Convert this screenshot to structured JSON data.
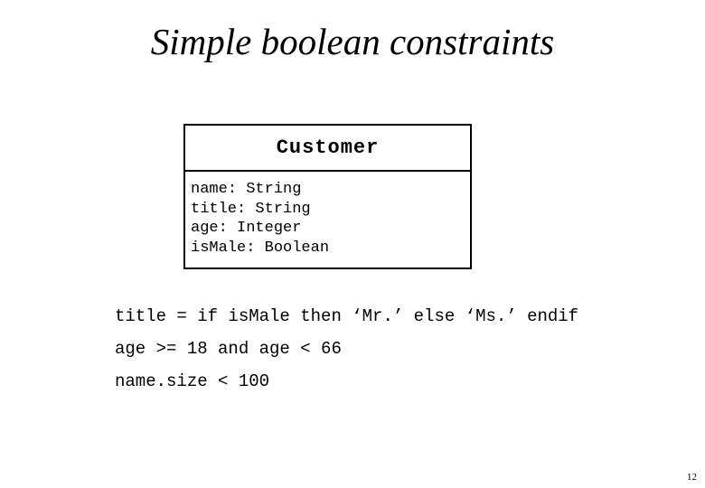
{
  "slide": {
    "title": "Simple boolean constraints",
    "page_number": "12",
    "background_color": "#ffffff",
    "text_color": "#000000"
  },
  "class_box": {
    "name": "Customer",
    "attributes": [
      {
        "text": "name: String"
      },
      {
        "text": "title: String"
      },
      {
        "text": "age: Integer"
      },
      {
        "text": "isMale: Boolean"
      }
    ]
  },
  "constraints": [
    {
      "text": "title = if isMale then ‘Mr.’ else ‘Ms.’ endif"
    },
    {
      "text": "age >= 18 and age < 66"
    },
    {
      "text": "name.size < 100"
    }
  ]
}
